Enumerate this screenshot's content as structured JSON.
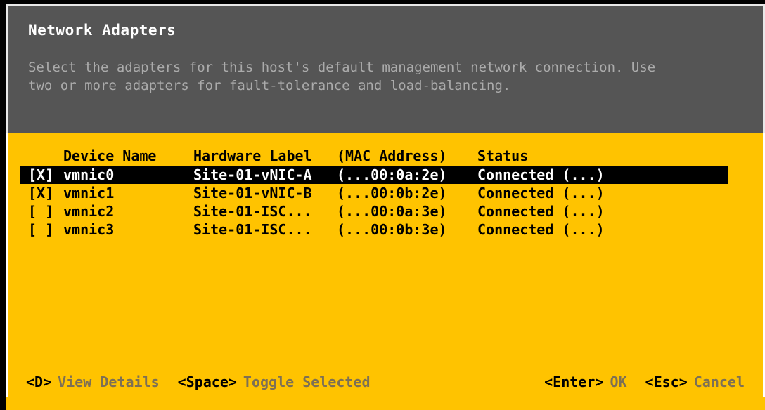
{
  "header": {
    "title": "Network Adapters",
    "description": "Select the adapters for this host's default management network connection. Use two or more adapters for fault-tolerance and load-balancing."
  },
  "table": {
    "columns": {
      "check": "",
      "device_name": "Device Name",
      "hardware_label": "Hardware Label",
      "mac_address": "(MAC Address)",
      "status": "Status"
    },
    "rows": [
      {
        "check": "[X]",
        "device_name": "vmnic0",
        "hardware_label": "Site-01-vNIC-A",
        "mac_address": "(...00:0a:2e)",
        "status": "Connected (...)",
        "selected": true,
        "checked": true
      },
      {
        "check": "[X]",
        "device_name": "vmnic1",
        "hardware_label": "Site-01-vNIC-B",
        "mac_address": "(...00:0b:2e)",
        "status": "Connected (...)",
        "selected": false,
        "checked": true
      },
      {
        "check": "[ ]",
        "device_name": "vmnic2",
        "hardware_label": "Site-01-ISC...",
        "mac_address": "(...00:0a:3e)",
        "status": "Connected (...)",
        "selected": false,
        "checked": false
      },
      {
        "check": "[ ]",
        "device_name": "vmnic3",
        "hardware_label": "Site-01-ISC...",
        "mac_address": "(...00:0b:3e)",
        "status": "Connected (...)",
        "selected": false,
        "checked": false
      }
    ]
  },
  "footer": {
    "left": [
      {
        "key": "<D>",
        "label": "View Details"
      },
      {
        "key": "<Space>",
        "label": "Toggle Selected"
      }
    ],
    "right": [
      {
        "key": "<Enter>",
        "label": "OK"
      },
      {
        "key": "<Esc>",
        "label": "Cancel"
      }
    ]
  },
  "colors": {
    "accent_yellow": "#ffc300",
    "header_grey": "#555555",
    "border_white": "#ffffff",
    "selection_black": "#000000",
    "desc_grey": "#ababab",
    "footer_label": "#7d7055"
  }
}
